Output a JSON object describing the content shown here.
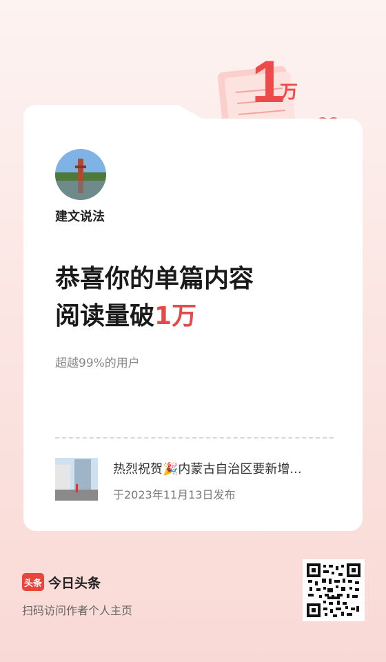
{
  "badge": {
    "number": "1",
    "unit": "万"
  },
  "author": {
    "name": "建文说法"
  },
  "headline": {
    "line1": "恭喜你的单篇内容",
    "line2_prefix": "阅读量破",
    "line2_highlight": "1万"
  },
  "subtitle": "超越99%的用户",
  "article": {
    "title": "热烈祝贺🎉内蒙古自治区要新增...",
    "date": "于2023年11月13日发布"
  },
  "footer": {
    "logo_text": "头条",
    "brand": "今日头条",
    "desc": "扫码访问作者个人主页"
  },
  "colors": {
    "accent": "#e34a4a",
    "brand_red": "#e8453c"
  }
}
